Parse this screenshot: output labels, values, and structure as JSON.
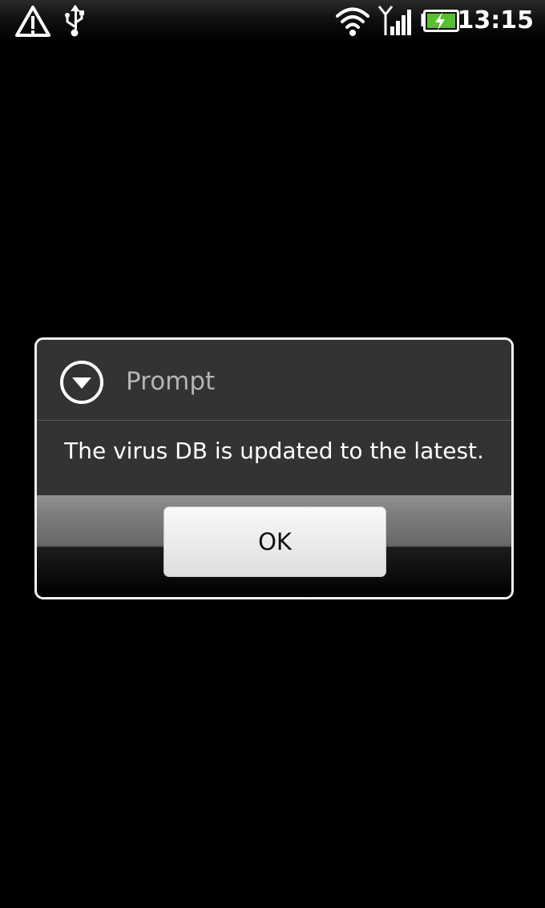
{
  "status_bar": {
    "time": "13:15",
    "icons": [
      "alert-triangle-icon",
      "usb-icon",
      "wifi-icon",
      "signal-icon",
      "battery-charging-icon"
    ]
  },
  "dialog": {
    "icon": "chevron-down-circle-icon",
    "title": "Prompt",
    "message": "The virus DB is updated to the latest.",
    "ok_label": "OK"
  }
}
